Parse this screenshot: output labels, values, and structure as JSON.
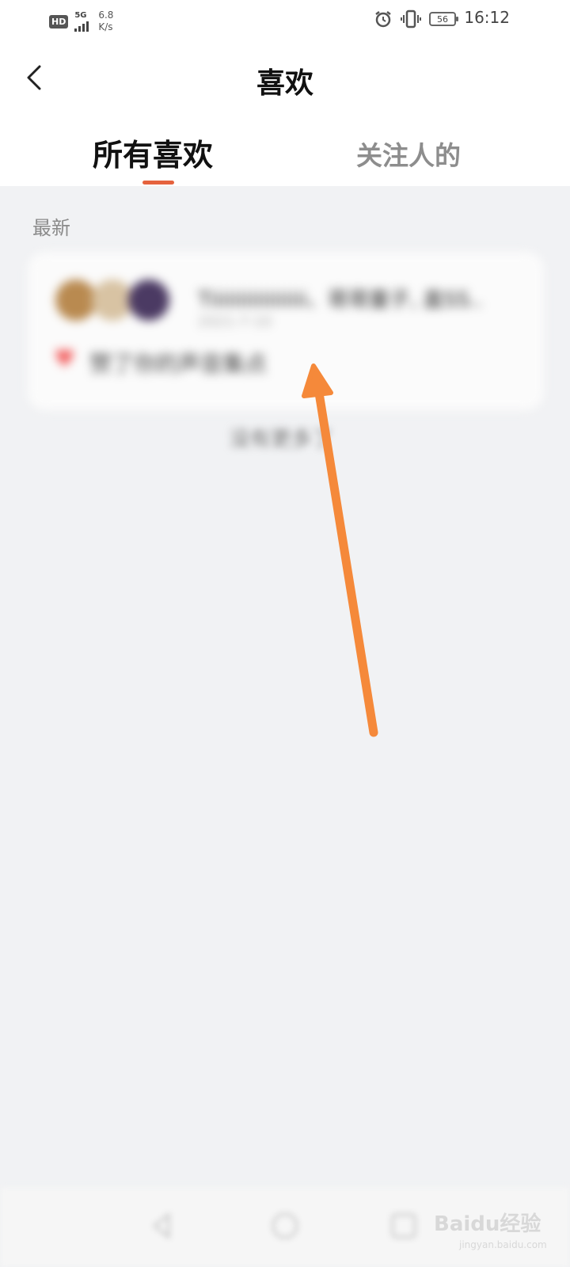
{
  "status_bar": {
    "hd": "HD",
    "network": "5G",
    "speed_value": "6.8",
    "speed_unit": "K/s",
    "battery": "56",
    "time": "16:12"
  },
  "header": {
    "title": "喜欢",
    "tabs": [
      {
        "label": "所有喜欢",
        "active": true
      },
      {
        "label": "关注人的",
        "active": false
      }
    ]
  },
  "section": {
    "label": "最新"
  },
  "card": {
    "names": "Tiiiiiiiiiiiiiiiii、哥哥童子, 盖SS..",
    "date": "2021-7-10",
    "description": "赞了你的声音集点"
  },
  "load_more": "没有更多了",
  "watermark": {
    "brand": "Baidu经验",
    "sub": "jingyan.baidu.com"
  },
  "colors": {
    "accent": "#e5623d",
    "arrow": "#f5893a",
    "background": "#f1f2f4"
  }
}
